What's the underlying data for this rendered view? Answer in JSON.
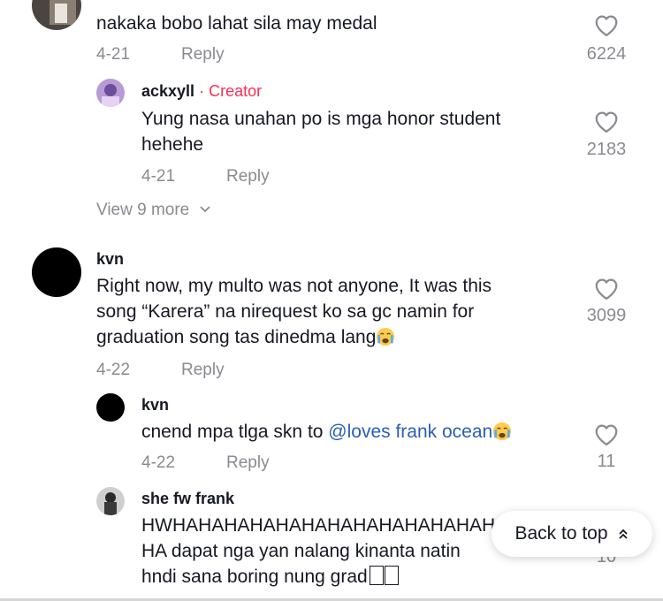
{
  "comments": [
    {
      "text": "nakaka bobo lahat sila may medal",
      "date": "4-21",
      "reply_label": "Reply",
      "likes": "6224",
      "replies": [
        {
          "username": "ackxyll",
          "creator_badge": "· Creator",
          "text_lines": [
            "Yung nasa unahan po is mga honor student",
            "hehehe"
          ],
          "date": "4-21",
          "reply_label": "Reply",
          "likes": "2183"
        }
      ],
      "view_more": "View 9 more"
    },
    {
      "username": "kvn",
      "text_lines": [
        "Right now, my multo was not anyone, It was this",
        "song “Karera” na nirequest ko sa gc namin for",
        "graduation song tas dinedma lang"
      ],
      "emoji": "crying-face",
      "date": "4-22",
      "reply_label": "Reply",
      "likes": "3099",
      "replies": [
        {
          "username": "kvn",
          "text_prefix": "cnend mpa tlga skn to ",
          "mention": "@loves frank ocean",
          "emoji": "crying-face",
          "date": "4-22",
          "reply_label": "Reply",
          "likes": "11"
        },
        {
          "username": "she fw frank",
          "text_lines": [
            "HWHAHAHAHAHAHAHAHAHAHAHAHAH",
            "HA dapat nga yan nalang kinanta natin",
            "hndi sana boring nung grad"
          ],
          "likes": "10"
        }
      ]
    }
  ],
  "back_to_top": "Back to top",
  "colors": {
    "creator": "#fe2c55",
    "mention": "#2b5db9",
    "muted": "#8a8b91",
    "text": "#161823"
  }
}
